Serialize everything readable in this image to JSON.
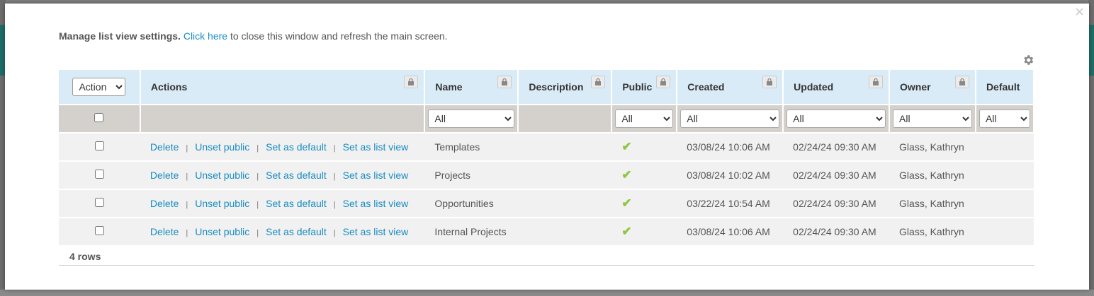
{
  "intro": {
    "bold": "Manage list view settings.",
    "link": "Click here",
    "rest": " to close this window and refresh the main screen."
  },
  "header": {
    "action_select": "Action",
    "columns": [
      "Actions",
      "Name",
      "Description",
      "Public",
      "Created",
      "Updated",
      "Owner",
      "Default"
    ]
  },
  "filters": {
    "name": "All",
    "public": "All",
    "created": "All",
    "updated": "All",
    "owner": "All",
    "default": "All"
  },
  "row_actions": {
    "delete": "Delete",
    "unset_public": "Unset public",
    "set_default": "Set as default",
    "set_list_view": "Set as list view"
  },
  "rows": [
    {
      "name": "Templates",
      "public": true,
      "created": "03/08/24 10:06 AM",
      "updated": "02/24/24 09:30 AM",
      "owner": "Glass, Kathryn"
    },
    {
      "name": "Projects",
      "public": true,
      "created": "03/08/24 10:02 AM",
      "updated": "02/24/24 09:30 AM",
      "owner": "Glass, Kathryn"
    },
    {
      "name": "Opportunities",
      "public": true,
      "created": "03/22/24 10:54 AM",
      "updated": "02/24/24 09:30 AM",
      "owner": "Glass, Kathryn"
    },
    {
      "name": "Internal Projects",
      "public": true,
      "created": "03/08/24 10:06 AM",
      "updated": "02/24/24 09:30 AM",
      "owner": "Glass, Kathryn"
    }
  ],
  "footer": {
    "rows_count": "4 rows"
  },
  "close_symbol": "×",
  "check_symbol": "✔",
  "colors": {
    "link": "#1a8cc2",
    "header_bg": "#d9ebf7",
    "check": "#8dc63f"
  }
}
